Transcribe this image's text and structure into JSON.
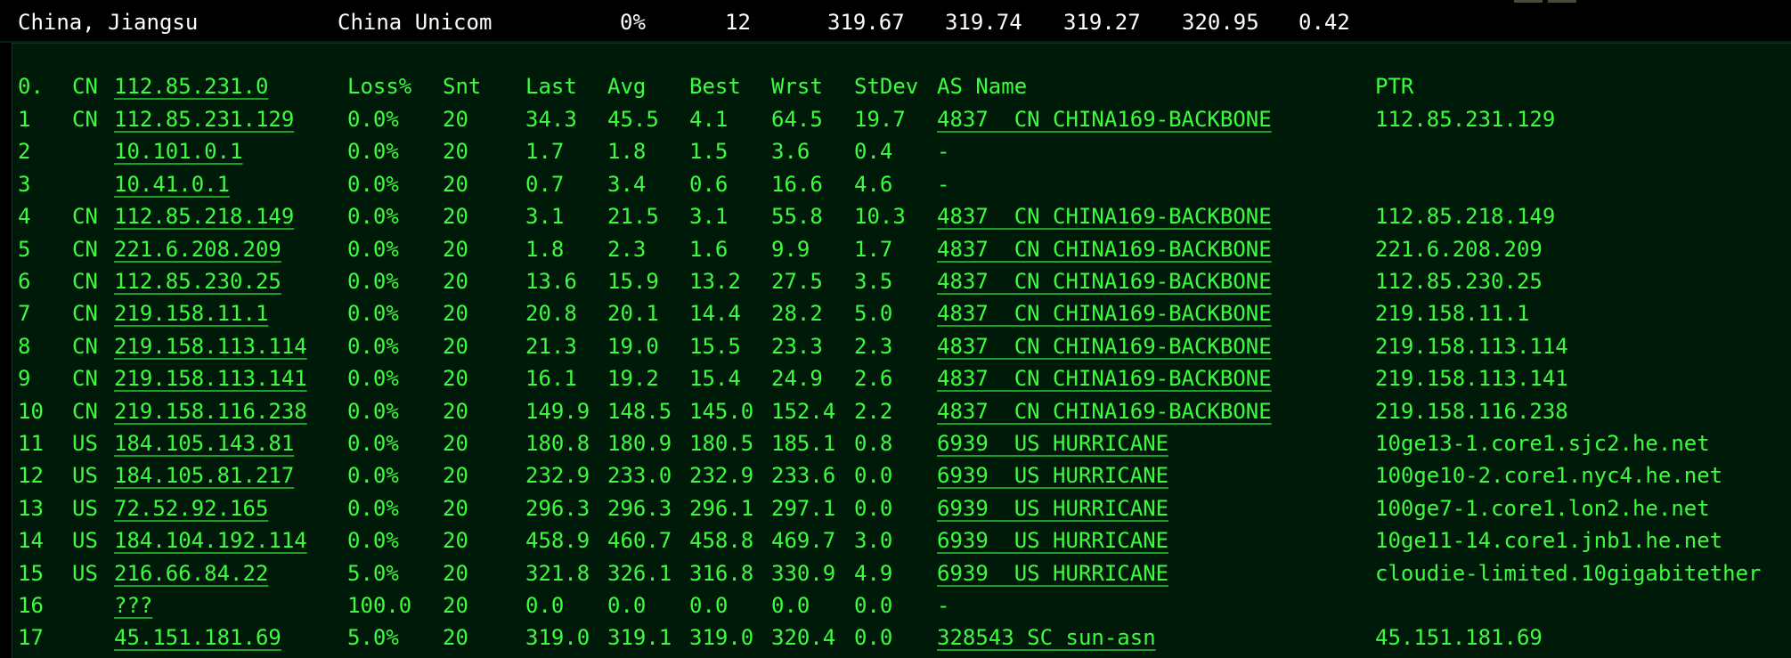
{
  "summary": {
    "location": "China, Jiangsu",
    "isp": "China Unicom",
    "loss": "0%",
    "sent": "12",
    "last": "319.67",
    "avg": "319.74",
    "best": "319.27",
    "worst": "320.95",
    "stdev": "0.42"
  },
  "table": {
    "headers": {
      "hop": "0.",
      "cc": "CN",
      "host": "112.85.231.0",
      "loss": "Loss%",
      "snt": "Snt",
      "last": "Last",
      "avg": "Avg",
      "best": "Best",
      "wrst": "Wrst",
      "stdev": "StDev",
      "as_name": "AS Name",
      "ptr": "PTR"
    },
    "rows": [
      {
        "hop": "1",
        "cc": "CN",
        "host": "112.85.231.129",
        "loss": "0.0%",
        "snt": "20",
        "last": "34.3",
        "avg": "45.5",
        "best": "4.1",
        "wrst": "64.5",
        "stdev": "19.7",
        "as_name": "4837  CN CHINA169-BACKBONE",
        "ptr": "112.85.231.129"
      },
      {
        "hop": "2",
        "cc": "",
        "host": "10.101.0.1",
        "loss": "0.0%",
        "snt": "20",
        "last": "1.7",
        "avg": "1.8",
        "best": "1.5",
        "wrst": "3.6",
        "stdev": "0.4",
        "as_name": "-",
        "ptr": ""
      },
      {
        "hop": "3",
        "cc": "",
        "host": "10.41.0.1",
        "loss": "0.0%",
        "snt": "20",
        "last": "0.7",
        "avg": "3.4",
        "best": "0.6",
        "wrst": "16.6",
        "stdev": "4.6",
        "as_name": "-",
        "ptr": ""
      },
      {
        "hop": "4",
        "cc": "CN",
        "host": "112.85.218.149",
        "loss": "0.0%",
        "snt": "20",
        "last": "3.1",
        "avg": "21.5",
        "best": "3.1",
        "wrst": "55.8",
        "stdev": "10.3",
        "as_name": "4837  CN CHINA169-BACKBONE",
        "ptr": "112.85.218.149"
      },
      {
        "hop": "5",
        "cc": "CN",
        "host": "221.6.208.209",
        "loss": "0.0%",
        "snt": "20",
        "last": "1.8",
        "avg": "2.3",
        "best": "1.6",
        "wrst": "9.9",
        "stdev": "1.7",
        "as_name": "4837  CN CHINA169-BACKBONE",
        "ptr": "221.6.208.209"
      },
      {
        "hop": "6",
        "cc": "CN",
        "host": "112.85.230.25",
        "loss": "0.0%",
        "snt": "20",
        "last": "13.6",
        "avg": "15.9",
        "best": "13.2",
        "wrst": "27.5",
        "stdev": "3.5",
        "as_name": "4837  CN CHINA169-BACKBONE",
        "ptr": "112.85.230.25"
      },
      {
        "hop": "7",
        "cc": "CN",
        "host": "219.158.11.1",
        "loss": "0.0%",
        "snt": "20",
        "last": "20.8",
        "avg": "20.1",
        "best": "14.4",
        "wrst": "28.2",
        "stdev": "5.0",
        "as_name": "4837  CN CHINA169-BACKBONE",
        "ptr": "219.158.11.1"
      },
      {
        "hop": "8",
        "cc": "CN",
        "host": "219.158.113.114",
        "loss": "0.0%",
        "snt": "20",
        "last": "21.3",
        "avg": "19.0",
        "best": "15.5",
        "wrst": "23.3",
        "stdev": "2.3",
        "as_name": "4837  CN CHINA169-BACKBONE",
        "ptr": "219.158.113.114"
      },
      {
        "hop": "9",
        "cc": "CN",
        "host": "219.158.113.141",
        "loss": "0.0%",
        "snt": "20",
        "last": "16.1",
        "avg": "19.2",
        "best": "15.4",
        "wrst": "24.9",
        "stdev": "2.6",
        "as_name": "4837  CN CHINA169-BACKBONE",
        "ptr": "219.158.113.141"
      },
      {
        "hop": "10",
        "cc": "CN",
        "host": "219.158.116.238",
        "loss": "0.0%",
        "snt": "20",
        "last": "149.9",
        "avg": "148.5",
        "best": "145.0",
        "wrst": "152.4",
        "stdev": "2.2",
        "as_name": "4837  CN CHINA169-BACKBONE",
        "ptr": "219.158.116.238"
      },
      {
        "hop": "11",
        "cc": "US",
        "host": "184.105.143.81",
        "loss": "0.0%",
        "snt": "20",
        "last": "180.8",
        "avg": "180.9",
        "best": "180.5",
        "wrst": "185.1",
        "stdev": "0.8",
        "as_name": "6939  US HURRICANE",
        "ptr": "10ge13-1.core1.sjc2.he.net"
      },
      {
        "hop": "12",
        "cc": "US",
        "host": "184.105.81.217",
        "loss": "0.0%",
        "snt": "20",
        "last": "232.9",
        "avg": "233.0",
        "best": "232.9",
        "wrst": "233.6",
        "stdev": "0.0",
        "as_name": "6939  US HURRICANE",
        "ptr": "100ge10-2.core1.nyc4.he.net"
      },
      {
        "hop": "13",
        "cc": "US",
        "host": "72.52.92.165",
        "loss": "0.0%",
        "snt": "20",
        "last": "296.3",
        "avg": "296.3",
        "best": "296.1",
        "wrst": "297.1",
        "stdev": "0.0",
        "as_name": "6939  US HURRICANE",
        "ptr": "100ge7-1.core1.lon2.he.net"
      },
      {
        "hop": "14",
        "cc": "US",
        "host": "184.104.192.114",
        "loss": "0.0%",
        "snt": "20",
        "last": "458.9",
        "avg": "460.7",
        "best": "458.8",
        "wrst": "469.7",
        "stdev": "3.0",
        "as_name": "6939  US HURRICANE",
        "ptr": "10ge11-14.core1.jnb1.he.net"
      },
      {
        "hop": "15",
        "cc": "US",
        "host": "216.66.84.22",
        "loss": "5.0%",
        "snt": "20",
        "last": "321.8",
        "avg": "326.1",
        "best": "316.8",
        "wrst": "330.9",
        "stdev": "4.9",
        "as_name": "6939  US HURRICANE",
        "ptr": "cloudie-limited.10gigabitether"
      },
      {
        "hop": "16",
        "cc": "",
        "host": "???",
        "loss": "100.0",
        "snt": "20",
        "last": "0.0",
        "avg": "0.0",
        "best": "0.0",
        "wrst": "0.0",
        "stdev": "0.0",
        "as_name": "-",
        "ptr": ""
      },
      {
        "hop": "17",
        "cc": "",
        "host": "45.151.181.69",
        "loss": "5.0%",
        "snt": "20",
        "last": "319.0",
        "avg": "319.1",
        "best": "319.0",
        "wrst": "320.4",
        "stdev": "0.0",
        "as_name": "328543 SC sun-asn",
        "ptr": "45.151.181.69"
      }
    ]
  }
}
